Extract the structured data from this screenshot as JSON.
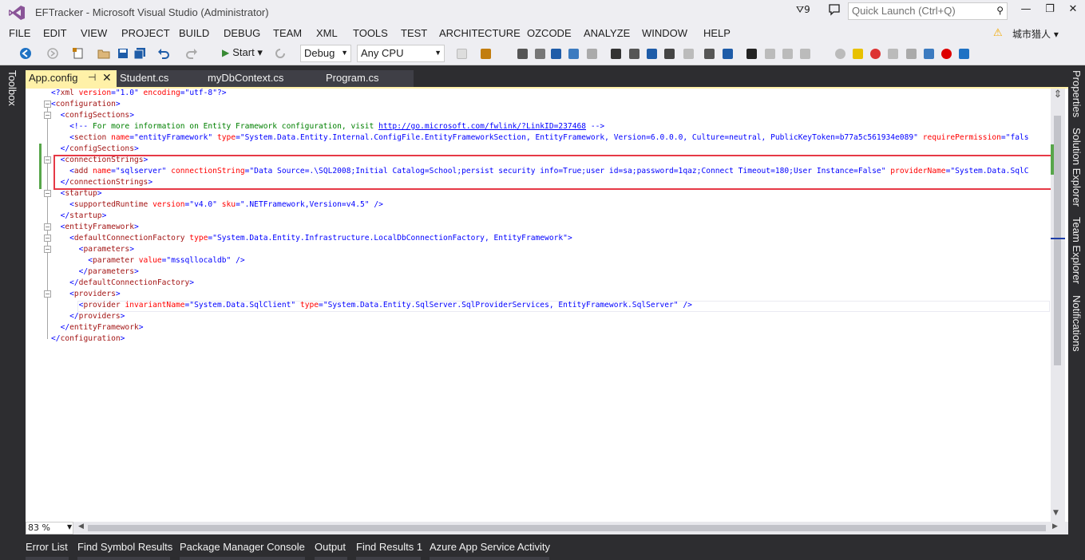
{
  "window": {
    "title": "EFTracker - Microsoft Visual Studio (Administrator)",
    "notification_count": "9",
    "quick_launch_placeholder": "Quick Launch (Ctrl+Q)",
    "user_name": "城市猎人"
  },
  "menu": [
    "FILE",
    "EDIT",
    "VIEW",
    "PROJECT",
    "BUILD",
    "DEBUG",
    "TEAM",
    "XML",
    "TOOLS",
    "TEST",
    "ARCHITECTURE",
    "OZCODE",
    "ANALYZE",
    "WINDOW",
    "HELP"
  ],
  "toolbar": {
    "start_label": "Start",
    "configuration": "Debug",
    "platform": "Any CPU"
  },
  "left_panel": {
    "toolbox_label": "Toolbox"
  },
  "tabs": [
    {
      "label": "App.config",
      "active": true
    },
    {
      "label": "Student.cs",
      "active": false
    },
    {
      "label": "myDbContext.cs",
      "active": false
    },
    {
      "label": "Program.cs",
      "active": false
    }
  ],
  "editor": {
    "zoom": "83 %",
    "lines": [
      "<?xml version=\"1.0\" encoding=\"utf-8\"?>",
      "<configuration>",
      "  <configSections>",
      "    <!-- For more information on Entity Framework configuration, visit http://go.microsoft.com/fwlink/?LinkID=237468 -->",
      "    <section name=\"entityFramework\" type=\"System.Data.Entity.Internal.ConfigFile.EntityFrameworkSection, EntityFramework, Version=6.0.0.0, Culture=neutral, PublicKeyToken=b77a5c561934e089\" requirePermission=\"fals",
      "  </configSections>",
      "  <connectionStrings>",
      "    <add name=\"sqlserver\" connectionString=\"Data Source=.\\SQL2008;Initial Catalog=School;persist security info=True;user id=sa;password=1qaz;Connect Timeout=180;User Instance=False\" providerName=\"System.Data.SqlC",
      "  </connectionStrings>",
      "  <startup>",
      "    <supportedRuntime version=\"v4.0\" sku=\".NETFramework,Version=v4.5\" />",
      "  </startup>",
      "  <entityFramework>",
      "    <defaultConnectionFactory type=\"System.Data.Entity.Infrastructure.LocalDbConnectionFactory, EntityFramework\">",
      "      <parameters>",
      "        <parameter value=\"mssqllocaldb\" />",
      "      </parameters>",
      "    </defaultConnectionFactory>",
      "    <providers>",
      "      <provider invariantName=\"System.Data.SqlClient\" type=\"System.Data.Entity.SqlServer.SqlProviderServices, EntityFramework.SqlServer\" />",
      "    </providers>",
      "  </entityFramework>",
      "</configuration>"
    ]
  },
  "right_panel": [
    "Properties",
    "Solution Explorer",
    "Team Explorer",
    "Notifications"
  ],
  "bottom_tabs": [
    "Error List",
    "Find Symbol Results",
    "Package Manager Console",
    "Output",
    "Find Results 1",
    "Azure App Service Activity"
  ],
  "colors": {
    "chrome_dark": "#2d2d30",
    "active_tab": "#fff1a8",
    "highlight_box": "#e63946",
    "change_marker": "#57a64a"
  }
}
